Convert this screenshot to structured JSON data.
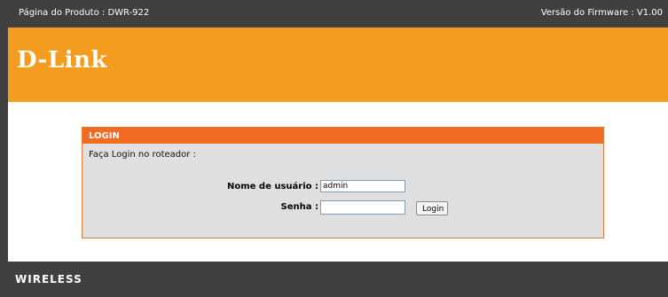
{
  "header": {
    "product_text": "Página do Produto : DWR-922",
    "firmware_text": "Versão do Firmware : V1.00"
  },
  "banner": {
    "logo_text": "D-Link"
  },
  "login": {
    "title": "LOGIN",
    "subtitle": "Faça Login no roteador :",
    "username_label": "Nome de usuário :",
    "username_value": "admin",
    "password_label": "Senha :",
    "password_value": "",
    "login_button": "Login"
  },
  "footer": {
    "brand_text": "WIRELESS"
  },
  "colors": {
    "orange_banner": "#f39c1f",
    "header_dark": "#404040",
    "login_header": "#f36a25"
  }
}
